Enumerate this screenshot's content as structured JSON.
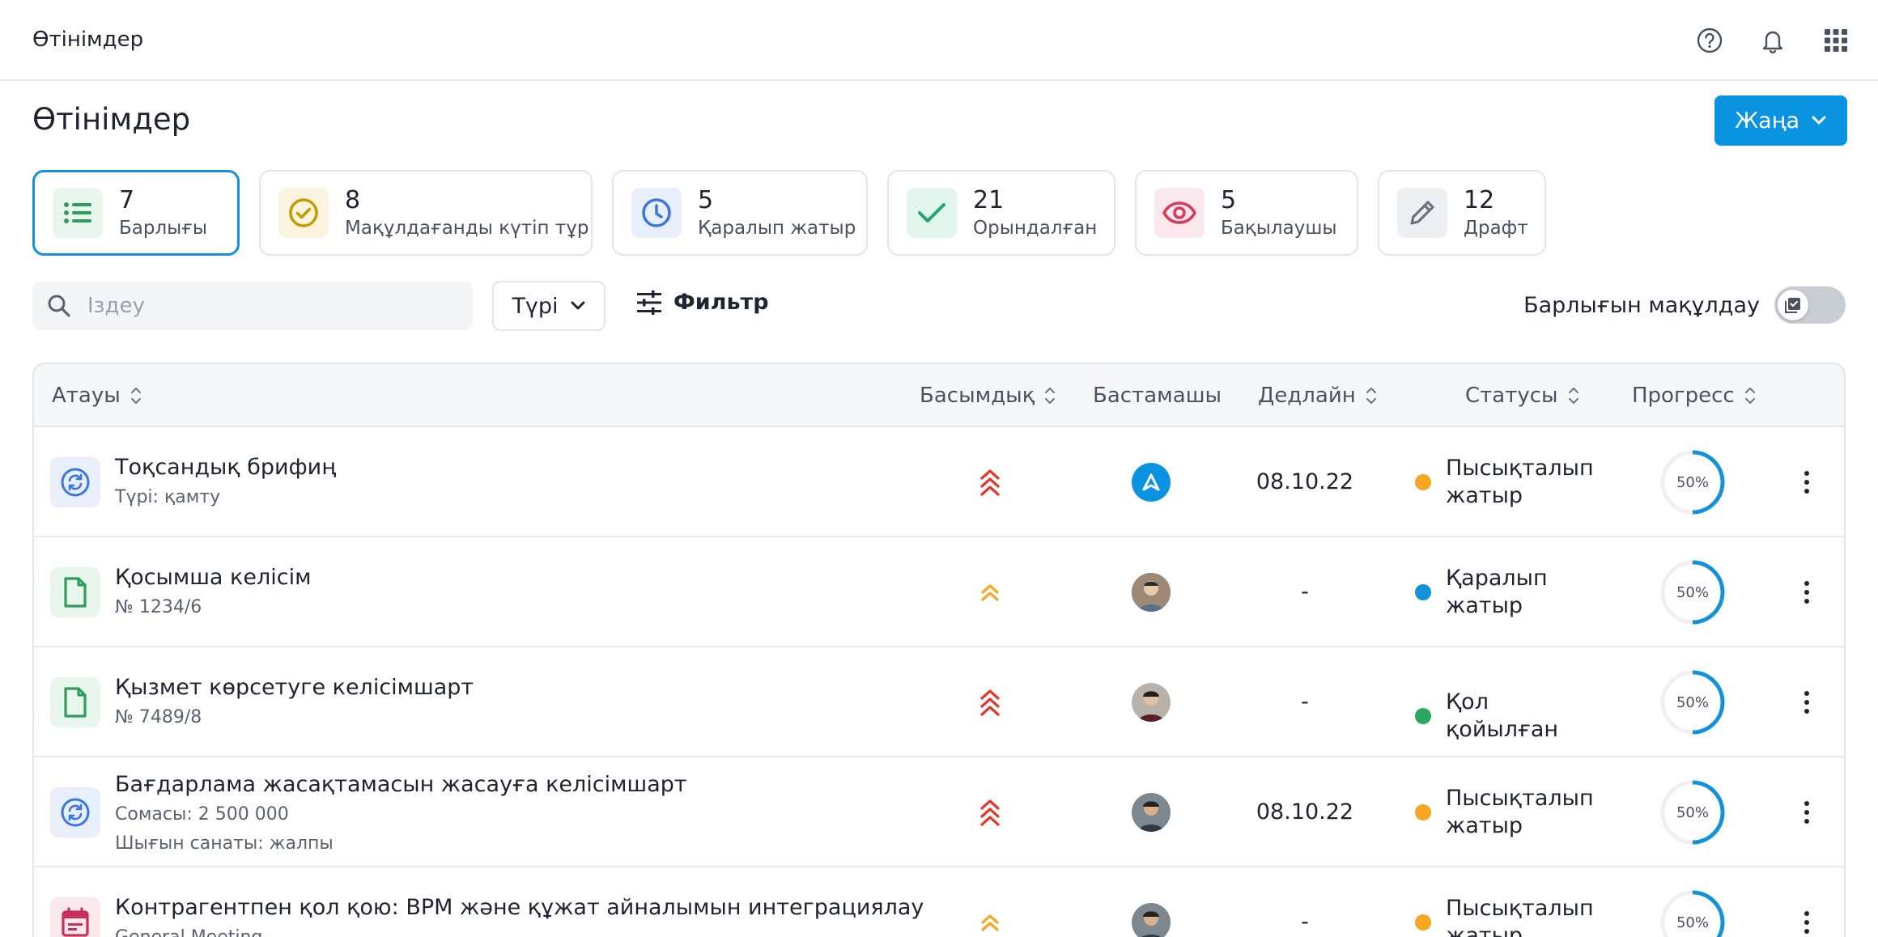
{
  "topbar": {
    "title": "Өтінімдер",
    "icons": [
      "help-icon",
      "bell-icon",
      "apps-grid-icon"
    ]
  },
  "page": {
    "title": "Өтінімдер",
    "new_button": "Жаңа"
  },
  "cards": [
    {
      "count": "7",
      "label": "Барлығы",
      "icon": "list-icon",
      "color": "#2e9d5b",
      "bg": "#e9f6ee"
    },
    {
      "count": "8",
      "label": "Мақұлдағанды күтіп тұр",
      "icon": "check-circle-icon",
      "color": "#c69a00",
      "bg": "#fbf4df"
    },
    {
      "count": "5",
      "label": "Қаралып жатыр",
      "icon": "clock-icon",
      "color": "#3a78e0",
      "bg": "#e8effb"
    },
    {
      "count": "21",
      "label": "Орындалған",
      "icon": "check-icon",
      "color": "#23a56c",
      "bg": "#e3f6ed"
    },
    {
      "count": "5",
      "label": "Бақылаушы",
      "icon": "eye-icon",
      "color": "#d63a55",
      "bg": "#fbe8ec"
    },
    {
      "count": "12",
      "label": "Драфт",
      "icon": "pencil-icon",
      "color": "#6c7280",
      "bg": "#eeeff2"
    }
  ],
  "filters": {
    "search_placeholder": "Іздеу",
    "type_label": "Түрі",
    "filter_label": "Фильтр",
    "approve_all_label": "Барлығын мақұлдау"
  },
  "table": {
    "columns": {
      "name": "Атауы",
      "priority": "Басымдық",
      "initiator": "Бастамашы",
      "deadline": "Дедлайн",
      "status": "Статусы",
      "progress": "Прогресс"
    },
    "rows": [
      {
        "title": "Тоқсандық брифиң",
        "sub1": "Түрі: қамту",
        "sub2": "",
        "icon": "sync-icon",
        "priority": "high",
        "deadline": "08.10.22",
        "status": "Пысықталып жатыр",
        "status_color": "#f5a623",
        "progress": "50%",
        "progress_value": 0.5
      },
      {
        "title": "Қосымша келісім",
        "sub1": "№ 1234/6",
        "sub2": "",
        "icon": "document-icon",
        "priority": "medium",
        "deadline": "-",
        "status": "Қаралып жатыр",
        "status_color": "#1392dc",
        "progress": "50%",
        "progress_value": 0.5
      },
      {
        "title": "Қызмет көрсетуге келісімшарт",
        "sub1": "№ 7489/8",
        "sub2": "",
        "icon": "document-icon",
        "priority": "high",
        "deadline": "-",
        "status": "Қол қойылған",
        "status_color": "#28a860",
        "progress": "50%",
        "progress_value": 0.5
      },
      {
        "title": "Бағдарлама жасақтамасын жасауға келісімшарт",
        "sub1": "Сомасы: 2 500 000",
        "sub2": "Шығын санаты: жалпы",
        "icon": "sync-icon",
        "priority": "high",
        "deadline": "08.10.22",
        "status": "Пысықталып жатыр",
        "status_color": "#f5a623",
        "progress": "50%",
        "progress_value": 0.5
      },
      {
        "title": "Контрагентпен қол қою: BPM және құжат айналымын интеграциялау",
        "sub1": "General Meeting",
        "sub2": "",
        "icon": "calendar-icon",
        "priority": "medium",
        "deadline": "-",
        "status": "Пысықталып жатыр",
        "status_color": "#f5a623",
        "progress": "50%",
        "progress_value": 0.5
      }
    ]
  }
}
